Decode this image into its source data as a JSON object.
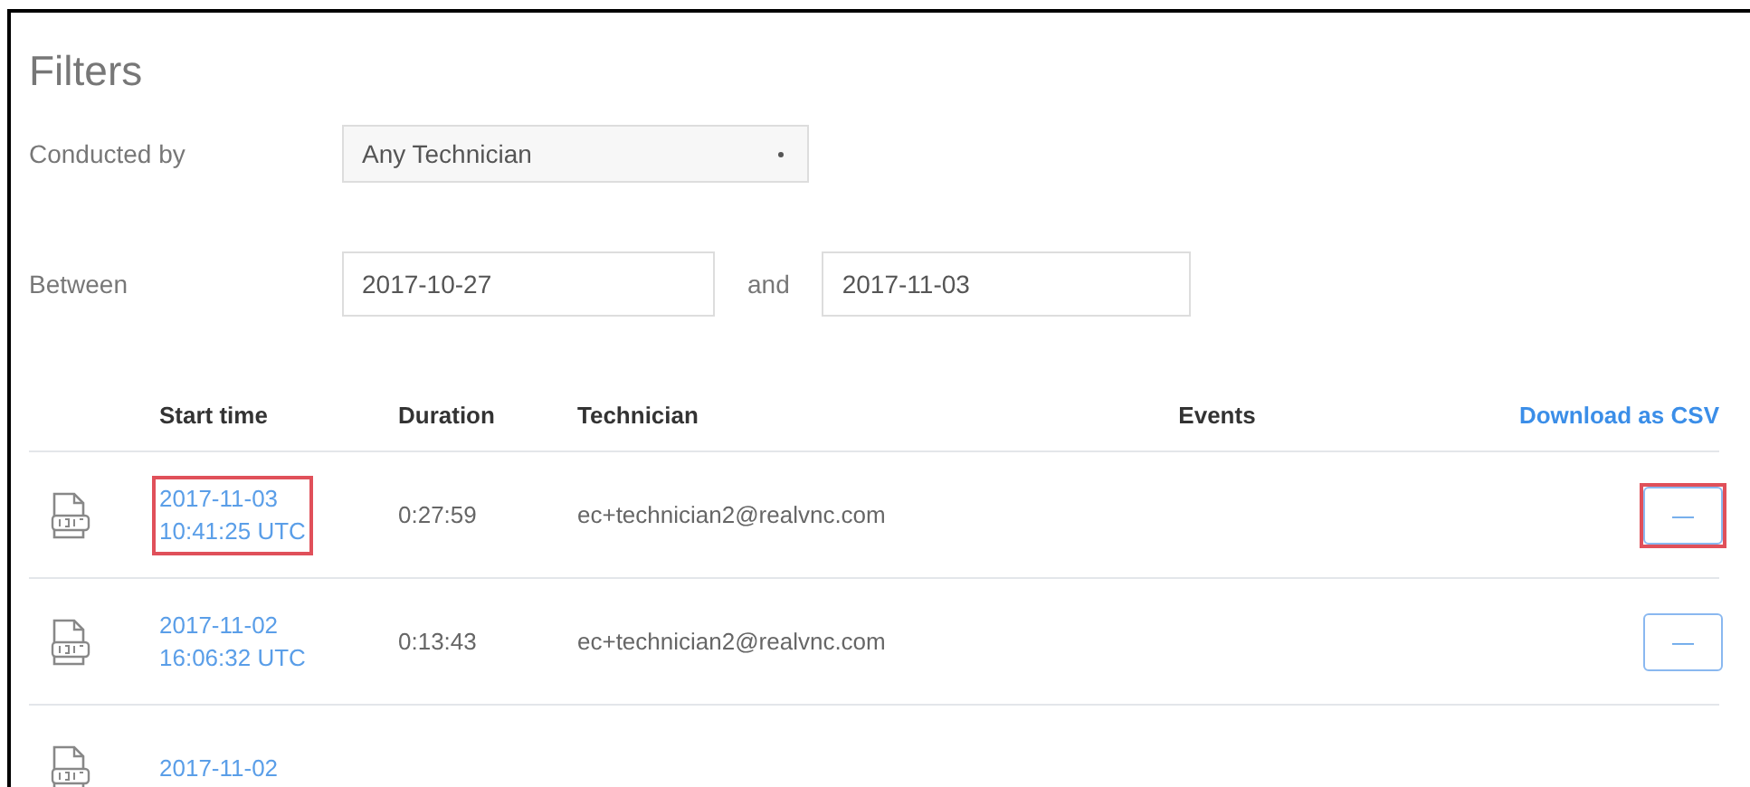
{
  "title": "Filters",
  "filters": {
    "conducted_by": {
      "label": "Conducted by",
      "value": "Any Technician"
    },
    "between": {
      "label": "Between",
      "from": "2017-10-27",
      "joiner": "and",
      "to": "2017-11-03"
    }
  },
  "table": {
    "columns": [
      "Start time",
      "Duration",
      "Technician",
      "Events"
    ],
    "download_link": "Download as CSV",
    "rows": [
      {
        "start_date": "2017-11-03",
        "start_time": "10:41:25 UTC",
        "duration": "0:27:59",
        "technician": "ec+technician2@realvnc.com",
        "button": "—",
        "highlighted": true
      },
      {
        "start_date": "2017-11-02",
        "start_time": "16:06:32 UTC",
        "duration": "0:13:43",
        "technician": "ec+technician2@realvnc.com",
        "button": "—",
        "highlighted": false
      },
      {
        "start_date": "2017-11-02",
        "highlighted": false
      }
    ]
  }
}
